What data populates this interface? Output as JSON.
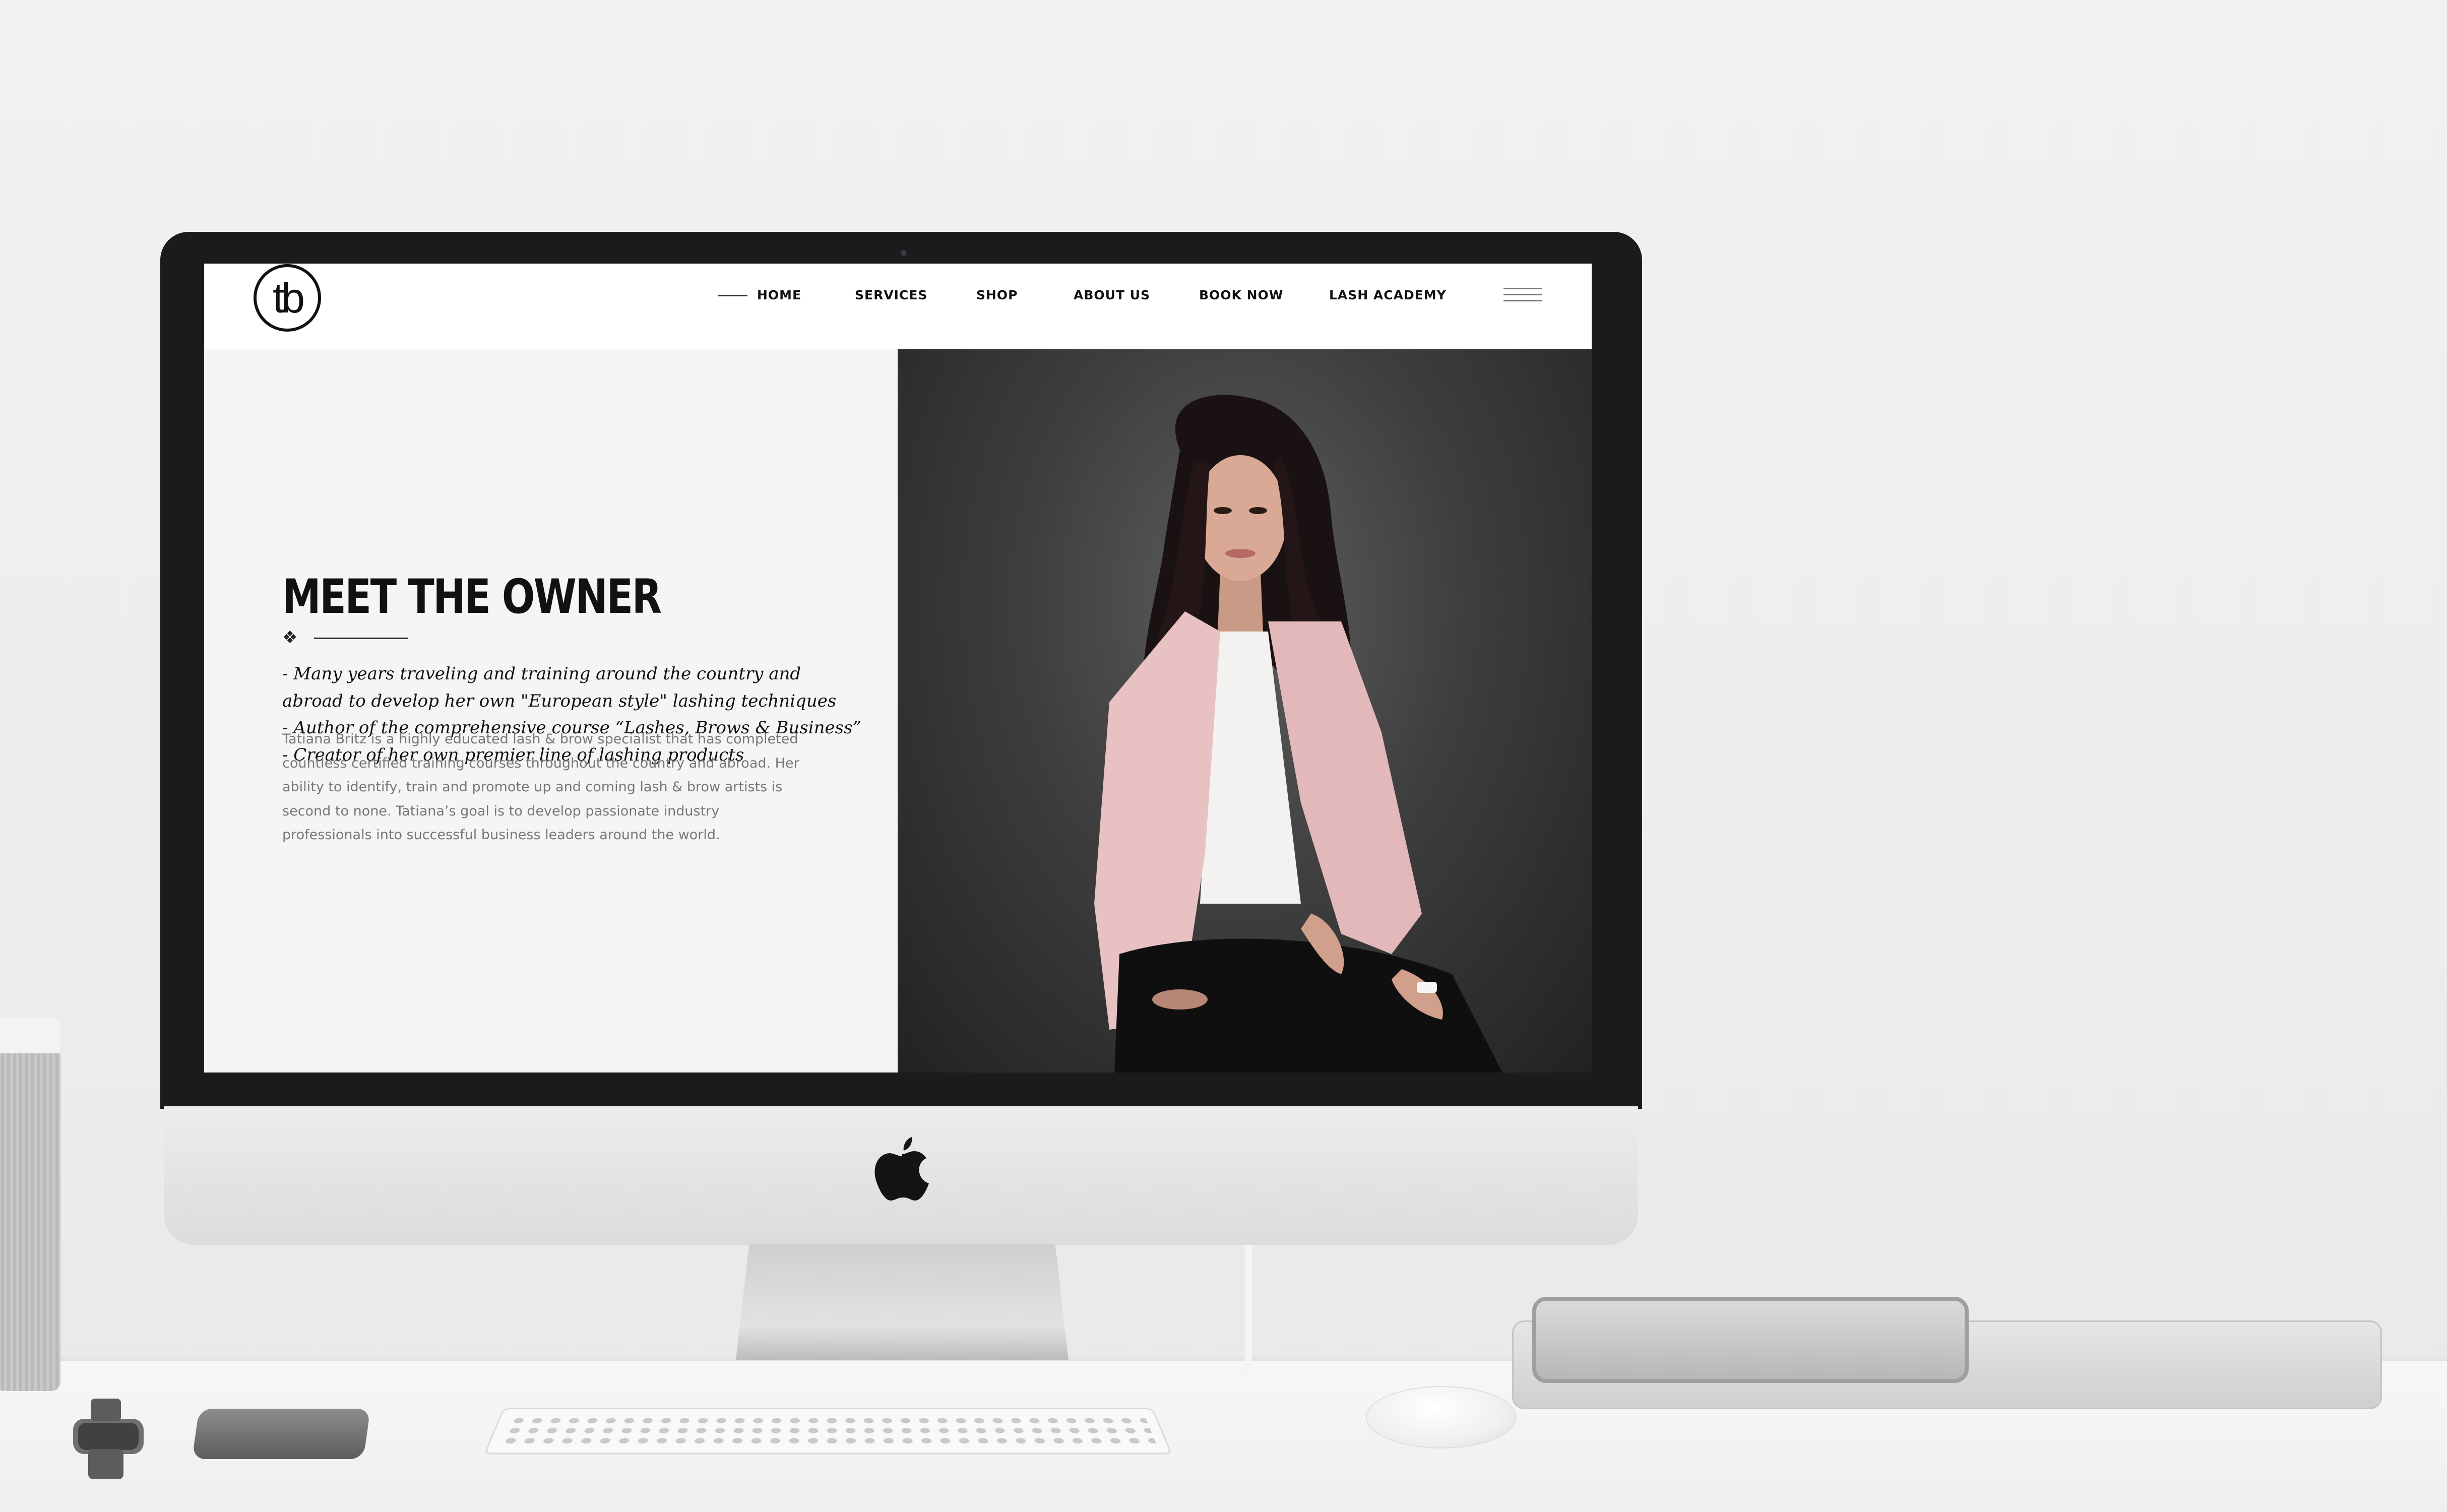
{
  "site": {
    "logo_text": "tb",
    "nav": {
      "items": [
        {
          "label": "HOME",
          "active": true
        },
        {
          "label": "SERVICES",
          "active": false
        },
        {
          "label": "SHOP",
          "active": false
        },
        {
          "label": "ABOUT US",
          "active": false
        },
        {
          "label": "BOOK NOW",
          "active": false
        },
        {
          "label": "LASH ACADEMY",
          "active": false
        }
      ],
      "menu_icon": "hamburger-icon"
    },
    "main": {
      "headline": "MEET THE OWNER",
      "ornament_icon": "diamond-ornament-icon",
      "bullets": [
        "- Many years traveling and training around the country and",
        "abroad to develop her own \"European style\" lashing techniques",
        "- Author of the comprehensive course “Lashes, Brows & Business”",
        "- Creator of her own premier line of lashing products"
      ],
      "bio": "Tatiana Britz is a highly educated lash & brow specialist that has completed countless certified training courses throughout the country and abroad. Her ability to identify, train and promote up and coming lash & brow artists is second to none. Tatiana’s goal is to develop passionate industry professionals into successful business leaders around the world."
    },
    "photo_alt": "portrait-photo"
  },
  "colors": {
    "header_bg": "#ffffff",
    "panel_bg": "#f6f4f4",
    "text_dark": "#111111",
    "text_muted": "#777777",
    "bezel": "#1b1b1b",
    "blazer_pink": "#e8c2c3"
  }
}
